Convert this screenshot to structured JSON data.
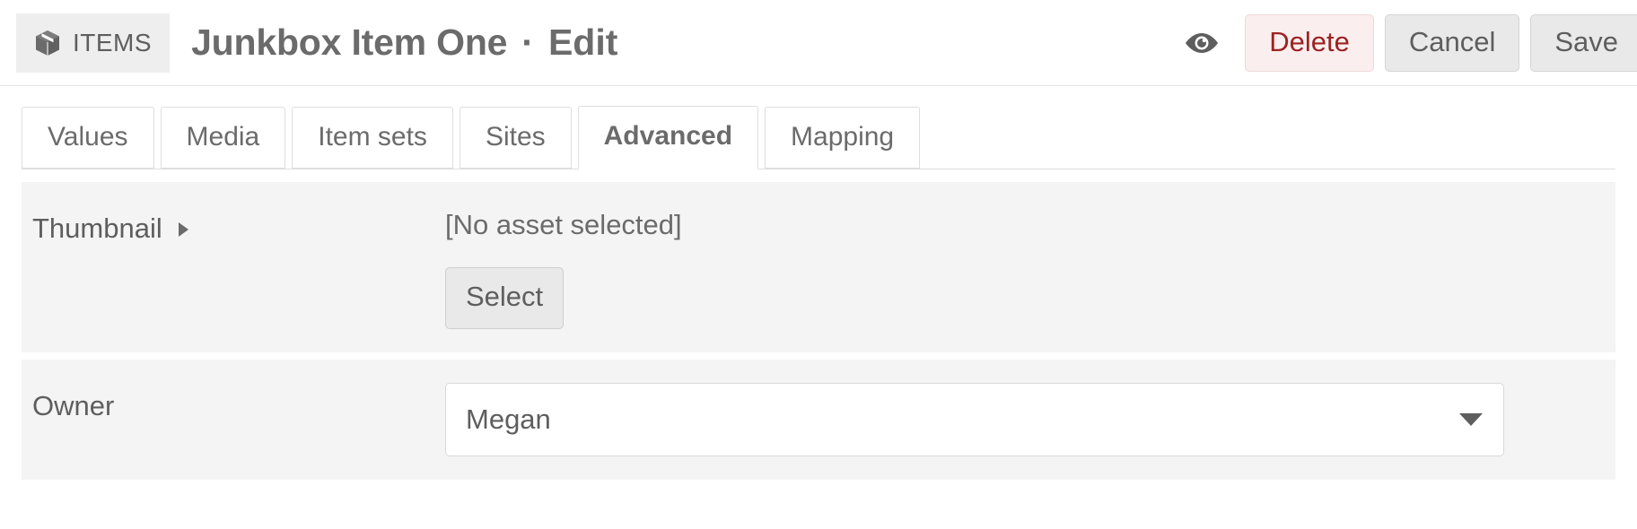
{
  "header": {
    "badge": {
      "icon": "cube-icon",
      "label": "ITEMS"
    },
    "title": "Junkbox Item One",
    "separator": "·",
    "action": "Edit",
    "preview_icon": "eye-icon",
    "buttons": {
      "delete": "Delete",
      "cancel": "Cancel",
      "save": "Save"
    },
    "colors": {
      "delete_text": "#9c2222",
      "delete_bg": "#fbeeee",
      "delete_border": "#f0d8d8",
      "button_bg": "#e9e9e9",
      "button_border": "#d4d4d4",
      "text": "#5e5e5e",
      "badge_bg": "#eeeeee"
    }
  },
  "tabs": [
    {
      "label": "Values",
      "active": false
    },
    {
      "label": "Media",
      "active": false
    },
    {
      "label": "Item sets",
      "active": false
    },
    {
      "label": "Sites",
      "active": false
    },
    {
      "label": "Advanced",
      "active": true
    },
    {
      "label": "Mapping",
      "active": false
    }
  ],
  "fields": {
    "thumbnail": {
      "label": "Thumbnail",
      "disclosure": "collapsed-right-triangle",
      "asset_status": "[No asset selected]",
      "select_button": "Select"
    },
    "owner": {
      "label": "Owner",
      "value": "Megan",
      "arrow_icon": "chevron-down-icon"
    }
  },
  "theme": {
    "row_bg": "#f4f4f4",
    "page_bg": "#ffffff",
    "border": "#dedede"
  }
}
